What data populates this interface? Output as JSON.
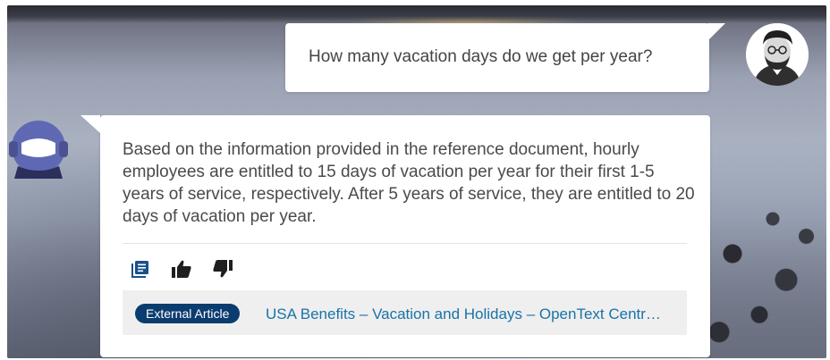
{
  "conversation": {
    "user_message": "How many vacation days do we get per year?",
    "bot_message": "Based on the information provided in the reference document, hourly employees are entitled to 15 days of vacation per year for their first 1-5 years of service, respectively. After 5 years of service, they are entitled to 20 days of vacation per year.",
    "actions": {
      "sources_icon": "document-list-icon",
      "like_icon": "thumbs-up-icon",
      "dislike_icon": "thumbs-down-icon"
    },
    "source": {
      "badge": "External Article",
      "title": "USA Benefits – Vacation and Holidays – OpenText Centr…"
    }
  },
  "colors": {
    "accent": "#0b3c6f",
    "link": "#1a73a8",
    "icon": "#1a4f8a",
    "bot_avatar": "#6f78c2"
  }
}
